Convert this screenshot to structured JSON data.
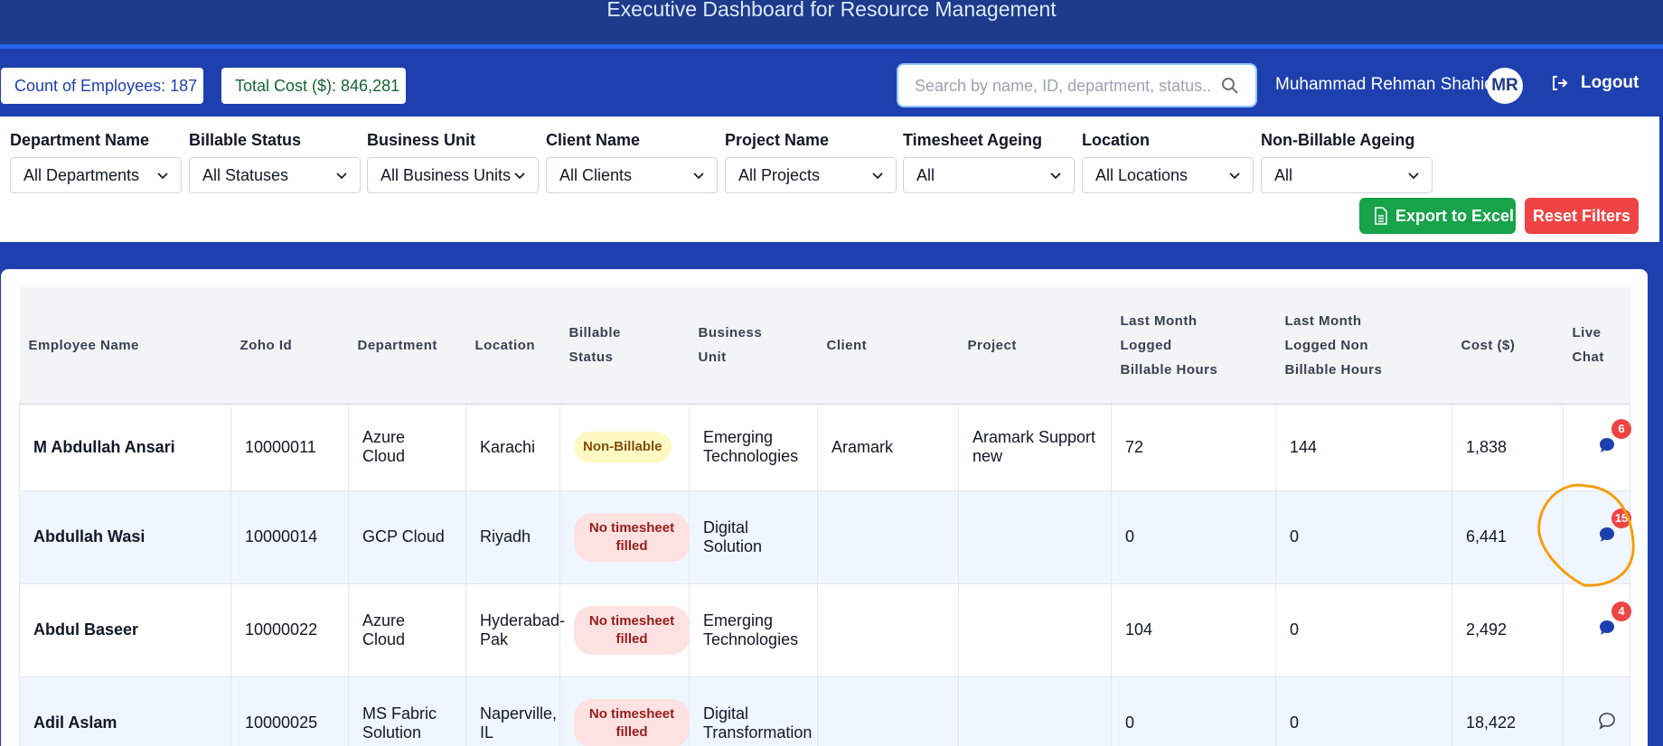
{
  "header": {
    "title": "Executive Dashboard for Resource Management"
  },
  "topbar": {
    "count_label": "Count of Employees: 187",
    "cost_label": "Total Cost ($): 846,281",
    "search_placeholder": "Search by name, ID, department, status...",
    "user_name": "Muhammad Rehman Shahid",
    "avatar_initials": "MR",
    "logout_label": "Logout"
  },
  "filters": [
    {
      "label": "Department Name",
      "value": "All Departments"
    },
    {
      "label": "Billable Status",
      "value": "All Statuses"
    },
    {
      "label": "Business Unit",
      "value": "All Business Units"
    },
    {
      "label": "Client Name",
      "value": "All Clients"
    },
    {
      "label": "Project Name",
      "value": "All Projects"
    },
    {
      "label": "Timesheet Ageing",
      "value": "All"
    },
    {
      "label": "Location",
      "value": "All Locations"
    },
    {
      "label": "Non-Billable Ageing",
      "value": "All"
    }
  ],
  "actions": {
    "export_label": "Export to Excel",
    "reset_label": "Reset Filters"
  },
  "table": {
    "columns": [
      {
        "l1": "Employee Name",
        "l2": "",
        "l3": ""
      },
      {
        "l1": "Zoho Id",
        "l2": "",
        "l3": ""
      },
      {
        "l1": "Department",
        "l2": "",
        "l3": ""
      },
      {
        "l1": "Location",
        "l2": "",
        "l3": ""
      },
      {
        "l1": "Billable",
        "l2": "Status",
        "l3": ""
      },
      {
        "l1": "Business",
        "l2": "Unit",
        "l3": ""
      },
      {
        "l1": "Client",
        "l2": "",
        "l3": ""
      },
      {
        "l1": "Project",
        "l2": "",
        "l3": ""
      },
      {
        "l1": "Last Month",
        "l2": "Logged",
        "l3": "Billable Hours"
      },
      {
        "l1": "Last Month",
        "l2": "Logged Non",
        "l3": "Billable Hours"
      },
      {
        "l1": "Cost ($)",
        "l2": "",
        "l3": ""
      },
      {
        "l1": "Live",
        "l2": "Chat",
        "l3": ""
      }
    ],
    "rows": [
      {
        "name": "M Abdullah Ansari",
        "zoho": "10000011",
        "dept": "Azure Cloud",
        "loc1": "Karachi",
        "loc2": "",
        "status1": "Non-Billable",
        "status2": "",
        "bu1": "Emerging",
        "bu2": "Technologies",
        "client": "Aramark",
        "proj1": "Aramark Support",
        "proj2": "new",
        "billable": "72",
        "nonbillable": "144",
        "cost": "1,838",
        "chat_count": "6"
      },
      {
        "name": "Abdullah Wasi",
        "zoho": "10000014",
        "dept": "GCP Cloud",
        "loc1": "Riyadh",
        "loc2": "",
        "status1": "No timesheet",
        "status2": "filled",
        "bu1": "Digital Solution",
        "bu2": "",
        "client": "",
        "proj1": "",
        "proj2": "",
        "billable": "0",
        "nonbillable": "0",
        "cost": "6,441",
        "chat_count": "15"
      },
      {
        "name": "Abdul Baseer",
        "zoho": "10000022",
        "dept": "Azure Cloud",
        "loc1": "Hyderabad-",
        "loc2": "Pak",
        "status1": "No timesheet",
        "status2": "filled",
        "bu1": "Emerging",
        "bu2": "Technologies",
        "client": "",
        "proj1": "",
        "proj2": "",
        "billable": "104",
        "nonbillable": "0",
        "cost": "2,492",
        "chat_count": "4"
      },
      {
        "name": "Adil Aslam",
        "zoho": "10000025",
        "dept1": "MS Fabric",
        "dept2": "Solution",
        "loc1": "Naperville,",
        "loc2": "IL",
        "status1": "No timesheet",
        "status2": "filled",
        "bu1": "Digital",
        "bu2": "Transformation",
        "client": "",
        "proj1": "",
        "proj2": "",
        "billable": "0",
        "nonbillable": "0",
        "cost": "18,422",
        "chat_count": ""
      }
    ]
  },
  "colors": {
    "primary": "#1e40af",
    "header": "#1e3a8a",
    "success": "#16a34a",
    "danger": "#ef4444",
    "annotation": "#f59e0b"
  },
  "icons": [
    "search-icon",
    "logout-icon",
    "chevron-down-icon",
    "file-spreadsheet-icon",
    "chat-bubble-icon",
    "chat-outline-icon"
  ]
}
